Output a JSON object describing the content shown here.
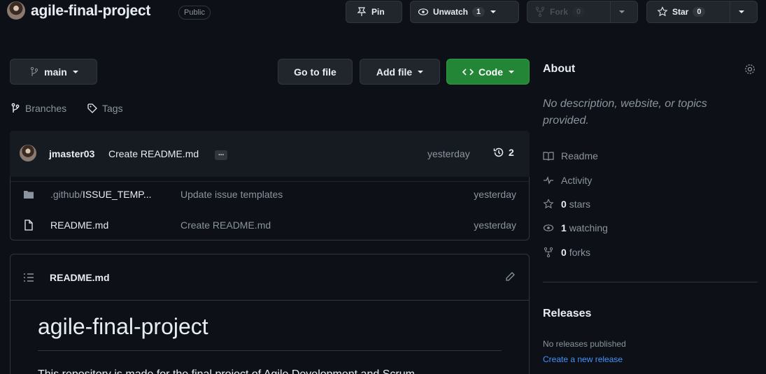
{
  "header": {
    "repo_name": "agile-final-project",
    "visibility": "Public",
    "pin_label": "Pin",
    "unwatch_label": "Unwatch",
    "unwatch_count": "1",
    "fork_label": "Fork",
    "fork_count": "0",
    "star_label": "Star",
    "star_count": "0"
  },
  "toolbar": {
    "branch": "main",
    "go_to_file": "Go to file",
    "add_file": "Add file",
    "code": "Code",
    "branches": "Branches",
    "tags": "Tags"
  },
  "commit": {
    "author": "jmaster03",
    "message": "Create README.md",
    "ellipsis": "...",
    "time": "yesterday",
    "count": "2"
  },
  "files": [
    {
      "name_prefix": ".github/",
      "name": "ISSUE_TEMP...",
      "message": "Update issue templates",
      "time": "yesterday",
      "type": "folder"
    },
    {
      "name_prefix": "",
      "name": "README.md",
      "message": "Create README.md",
      "time": "yesterday",
      "type": "file"
    }
  ],
  "readme": {
    "tab_label": "README.md",
    "heading": "agile-final-project",
    "body": "This repository is made for the final project of Agile Development and Scrum"
  },
  "about": {
    "title": "About",
    "description": "No description, website, or topics provided.",
    "readme": "Readme",
    "activity": "Activity",
    "stars_count": "0",
    "stars_label": "stars",
    "watching_count": "1",
    "watching_label": "watching",
    "forks_count": "0",
    "forks_label": "forks"
  },
  "releases": {
    "title": "Releases",
    "none": "No releases published",
    "create": "Create a new release"
  },
  "colors": {
    "accent": "#4493f8",
    "green": "#238636",
    "bg": "#0d1117",
    "border": "#30363d"
  }
}
